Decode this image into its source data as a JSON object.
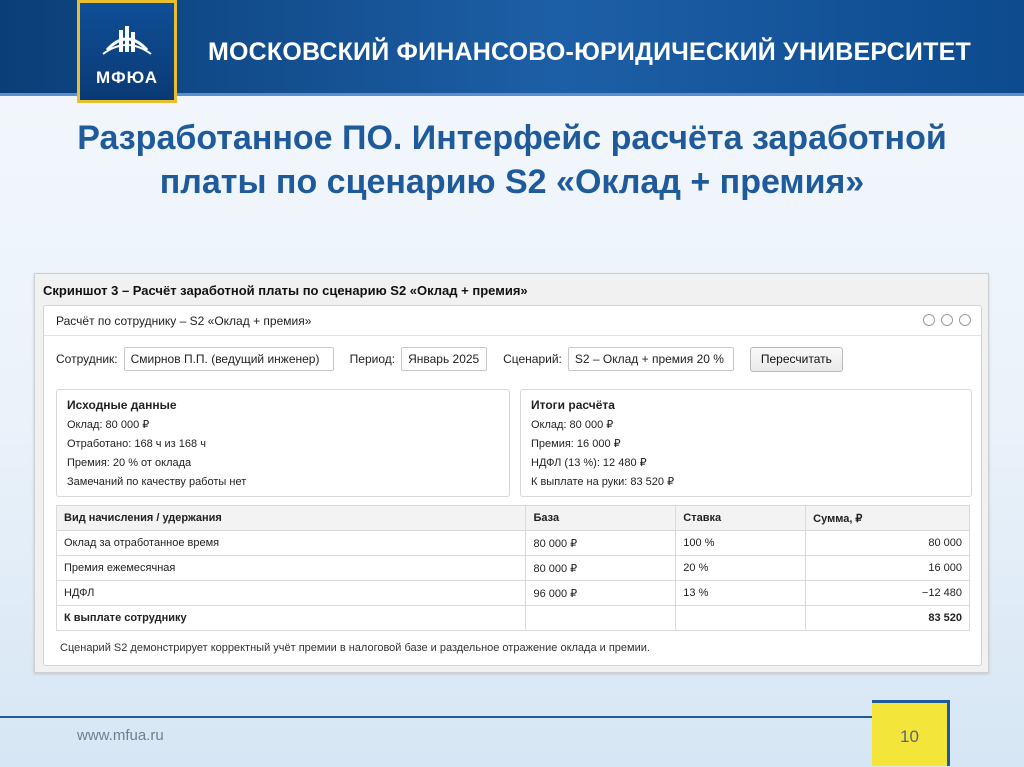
{
  "header": {
    "logo_text": "МФЮА",
    "university_name": "МОСКОВСКИЙ ФИНАНСОВО-ЮРИДИЧЕСКИЙ УНИВЕРСИТЕТ"
  },
  "slide": {
    "title": "Разработанное ПО. Интерфейс расчёта заработной платы по сценарию S2 «Оклад + премия»"
  },
  "screenshot": {
    "caption": "Скриншот 3 – Расчёт заработной платы по сценарию S2 «Оклад + премия»",
    "window_title": "Расчёт по сотруднику – S2 «Оклад + премия»",
    "form": {
      "employee_label": "Сотрудник:",
      "employee_value": "Смирнов П.П. (ведущий инженер)",
      "period_label": "Период:",
      "period_value": "Январь 2025",
      "scenario_label": "Сценарий:",
      "scenario_value": "S2 – Оклад + премия 20 %",
      "recalc_label": "Пересчитать"
    },
    "input_card": {
      "title": "Исходные данные",
      "lines": [
        "Оклад: 80 000 ₽",
        "Отработано: 168 ч из 168 ч",
        "Премия: 20 % от оклада",
        "Замечаний по качеству работы нет"
      ]
    },
    "result_card": {
      "title": "Итоги расчёта",
      "lines": [
        "Оклад: 80 000 ₽",
        "Премия: 16 000 ₽",
        "НДФЛ (13 %): 12 480 ₽",
        "К выплате на руки: 83 520 ₽"
      ]
    },
    "table": {
      "headers": [
        "Вид начисления / удержания",
        "База",
        "Ставка",
        "Сумма, ₽"
      ],
      "rows": [
        [
          "Оклад за отработанное время",
          "80 000 ₽",
          "100 %",
          "80 000"
        ],
        [
          "Премия ежемесячная",
          "80 000 ₽",
          "20 %",
          "16 000"
        ],
        [
          "НДФЛ",
          "96 000 ₽",
          "13 %",
          "−12 480"
        ],
        [
          "К выплате сотруднику",
          "",
          "",
          "83 520"
        ]
      ]
    },
    "note": "Сценарий S2 демонстрирует корректный учёт премии в налоговой базе и раздельное отражение оклада и премии."
  },
  "footer": {
    "url": "www.mfua.ru",
    "page_number": "10"
  },
  "colors": {
    "header_blue": "#0d4a8e",
    "title_blue": "#1f5a9a",
    "logo_gold": "#e7bf2f",
    "page_yellow": "#f4e53a"
  }
}
